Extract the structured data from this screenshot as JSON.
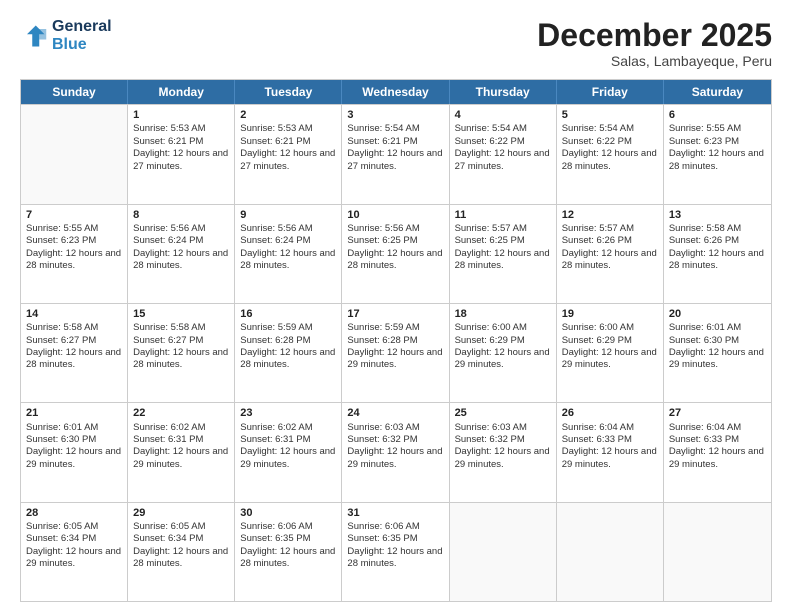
{
  "header": {
    "logo_line1": "General",
    "logo_line2": "Blue",
    "month": "December 2025",
    "location": "Salas, Lambayeque, Peru"
  },
  "weekdays": [
    "Sunday",
    "Monday",
    "Tuesday",
    "Wednesday",
    "Thursday",
    "Friday",
    "Saturday"
  ],
  "rows": [
    [
      {
        "day": "",
        "info": ""
      },
      {
        "day": "1",
        "sunrise": "5:53 AM",
        "sunset": "6:21 PM",
        "daylight": "12 hours and 27 minutes."
      },
      {
        "day": "2",
        "sunrise": "5:53 AM",
        "sunset": "6:21 PM",
        "daylight": "12 hours and 27 minutes."
      },
      {
        "day": "3",
        "sunrise": "5:54 AM",
        "sunset": "6:21 PM",
        "daylight": "12 hours and 27 minutes."
      },
      {
        "day": "4",
        "sunrise": "5:54 AM",
        "sunset": "6:22 PM",
        "daylight": "12 hours and 27 minutes."
      },
      {
        "day": "5",
        "sunrise": "5:54 AM",
        "sunset": "6:22 PM",
        "daylight": "12 hours and 28 minutes."
      },
      {
        "day": "6",
        "sunrise": "5:55 AM",
        "sunset": "6:23 PM",
        "daylight": "12 hours and 28 minutes."
      }
    ],
    [
      {
        "day": "7",
        "sunrise": "5:55 AM",
        "sunset": "6:23 PM",
        "daylight": "12 hours and 28 minutes."
      },
      {
        "day": "8",
        "sunrise": "5:56 AM",
        "sunset": "6:24 PM",
        "daylight": "12 hours and 28 minutes."
      },
      {
        "day": "9",
        "sunrise": "5:56 AM",
        "sunset": "6:24 PM",
        "daylight": "12 hours and 28 minutes."
      },
      {
        "day": "10",
        "sunrise": "5:56 AM",
        "sunset": "6:25 PM",
        "daylight": "12 hours and 28 minutes."
      },
      {
        "day": "11",
        "sunrise": "5:57 AM",
        "sunset": "6:25 PM",
        "daylight": "12 hours and 28 minutes."
      },
      {
        "day": "12",
        "sunrise": "5:57 AM",
        "sunset": "6:26 PM",
        "daylight": "12 hours and 28 minutes."
      },
      {
        "day": "13",
        "sunrise": "5:58 AM",
        "sunset": "6:26 PM",
        "daylight": "12 hours and 28 minutes."
      }
    ],
    [
      {
        "day": "14",
        "sunrise": "5:58 AM",
        "sunset": "6:27 PM",
        "daylight": "12 hours and 28 minutes."
      },
      {
        "day": "15",
        "sunrise": "5:58 AM",
        "sunset": "6:27 PM",
        "daylight": "12 hours and 28 minutes."
      },
      {
        "day": "16",
        "sunrise": "5:59 AM",
        "sunset": "6:28 PM",
        "daylight": "12 hours and 28 minutes."
      },
      {
        "day": "17",
        "sunrise": "5:59 AM",
        "sunset": "6:28 PM",
        "daylight": "12 hours and 29 minutes."
      },
      {
        "day": "18",
        "sunrise": "6:00 AM",
        "sunset": "6:29 PM",
        "daylight": "12 hours and 29 minutes."
      },
      {
        "day": "19",
        "sunrise": "6:00 AM",
        "sunset": "6:29 PM",
        "daylight": "12 hours and 29 minutes."
      },
      {
        "day": "20",
        "sunrise": "6:01 AM",
        "sunset": "6:30 PM",
        "daylight": "12 hours and 29 minutes."
      }
    ],
    [
      {
        "day": "21",
        "sunrise": "6:01 AM",
        "sunset": "6:30 PM",
        "daylight": "12 hours and 29 minutes."
      },
      {
        "day": "22",
        "sunrise": "6:02 AM",
        "sunset": "6:31 PM",
        "daylight": "12 hours and 29 minutes."
      },
      {
        "day": "23",
        "sunrise": "6:02 AM",
        "sunset": "6:31 PM",
        "daylight": "12 hours and 29 minutes."
      },
      {
        "day": "24",
        "sunrise": "6:03 AM",
        "sunset": "6:32 PM",
        "daylight": "12 hours and 29 minutes."
      },
      {
        "day": "25",
        "sunrise": "6:03 AM",
        "sunset": "6:32 PM",
        "daylight": "12 hours and 29 minutes."
      },
      {
        "day": "26",
        "sunrise": "6:04 AM",
        "sunset": "6:33 PM",
        "daylight": "12 hours and 29 minutes."
      },
      {
        "day": "27",
        "sunrise": "6:04 AM",
        "sunset": "6:33 PM",
        "daylight": "12 hours and 29 minutes."
      }
    ],
    [
      {
        "day": "28",
        "sunrise": "6:05 AM",
        "sunset": "6:34 PM",
        "daylight": "12 hours and 29 minutes."
      },
      {
        "day": "29",
        "sunrise": "6:05 AM",
        "sunset": "6:34 PM",
        "daylight": "12 hours and 28 minutes."
      },
      {
        "day": "30",
        "sunrise": "6:06 AM",
        "sunset": "6:35 PM",
        "daylight": "12 hours and 28 minutes."
      },
      {
        "day": "31",
        "sunrise": "6:06 AM",
        "sunset": "6:35 PM",
        "daylight": "12 hours and 28 minutes."
      },
      {
        "day": "",
        "info": ""
      },
      {
        "day": "",
        "info": ""
      },
      {
        "day": "",
        "info": ""
      }
    ]
  ]
}
